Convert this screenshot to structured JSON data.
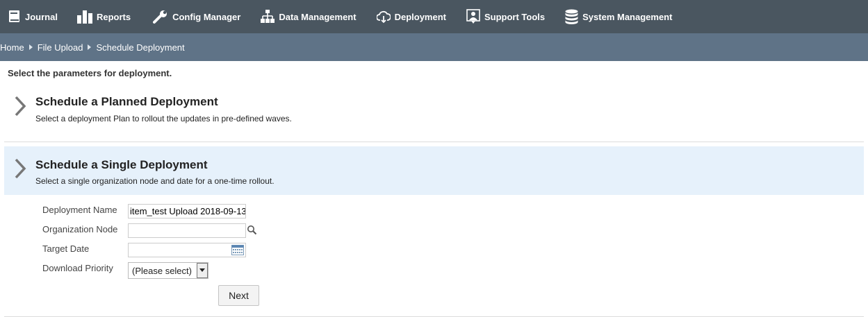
{
  "nav": {
    "items": [
      {
        "label": "Journal",
        "icon": "journal-icon"
      },
      {
        "label": "Reports",
        "icon": "reports-icon"
      },
      {
        "label": "Config Manager",
        "icon": "wrench-icon"
      },
      {
        "label": "Data Management",
        "icon": "hierarchy-icon"
      },
      {
        "label": "Deployment",
        "icon": "cloud-download-icon"
      },
      {
        "label": "Support Tools",
        "icon": "support-icon"
      },
      {
        "label": "System Management",
        "icon": "database-icon"
      }
    ]
  },
  "breadcrumb": {
    "home": "Home",
    "file_upload": "File Upload",
    "current": "Schedule Deployment"
  },
  "main": {
    "intro": "Select the parameters for deployment.",
    "planned": {
      "title": "Schedule a Planned Deployment",
      "description": "Select a deployment Plan to rollout the updates in pre-defined waves."
    },
    "single": {
      "title": "Schedule a Single Deployment",
      "description": "Select a single organization node and date for a one-time rollout."
    }
  },
  "form": {
    "deployment_name_label": "Deployment Name",
    "deployment_name_value": "item_test Upload 2018-09-13",
    "org_node_label": "Organization Node",
    "org_node_value": "",
    "target_date_label": "Target Date",
    "target_date_value": "",
    "priority_label": "Download Priority",
    "priority_selected": "(Please select)",
    "next_label": "Next"
  },
  "colors": {
    "topnav_bg": "#4a5660",
    "breadcrumb_bg": "#5f7387",
    "selected_section_bg": "#e6f1fb"
  }
}
